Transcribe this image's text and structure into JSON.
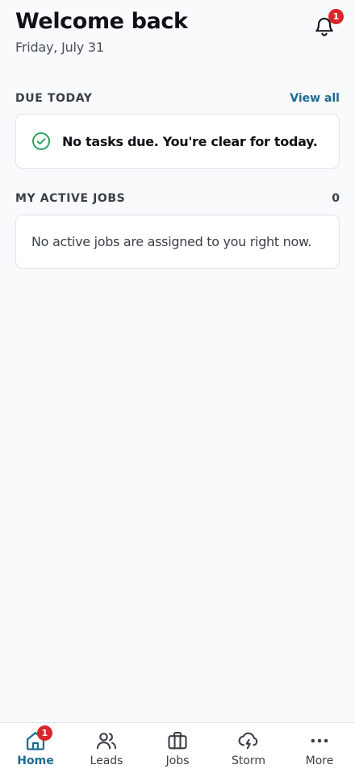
{
  "header": {
    "title": "Welcome back",
    "date": "Friday, July 31",
    "notification_count": "1"
  },
  "due_today": {
    "title": "DUE TODAY",
    "link_label": "View all",
    "empty_message": "No tasks due. You're clear for today."
  },
  "active_jobs": {
    "title": "MY ACTIVE JOBS",
    "count": "0",
    "empty_message": "No active jobs are assigned to you right now."
  },
  "nav": {
    "items": [
      {
        "label": "Home",
        "icon": "home-icon",
        "badge": "1",
        "active": true
      },
      {
        "label": "Leads",
        "icon": "users-icon"
      },
      {
        "label": "Jobs",
        "icon": "briefcase-icon"
      },
      {
        "label": "Storm",
        "icon": "storm-cloud-icon"
      },
      {
        "label": "More",
        "icon": "more-dots-icon"
      }
    ]
  },
  "colors": {
    "accent": "#1f6b8f",
    "badge": "#d9252b",
    "success": "#1e9e55",
    "background": "#f8fafc"
  }
}
